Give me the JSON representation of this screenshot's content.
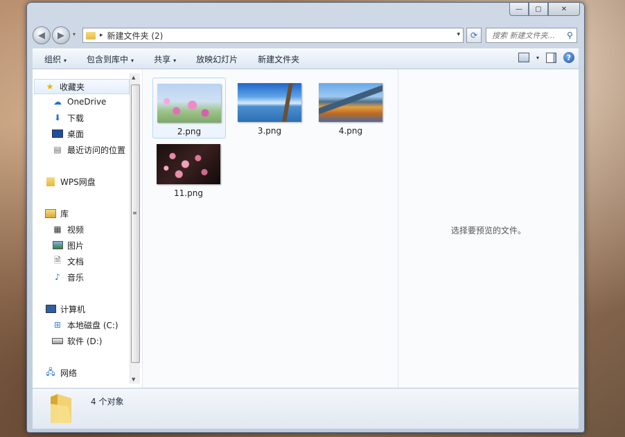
{
  "window": {
    "caption_buttons": [
      {
        "name": "minimize-button",
        "glyph": "—"
      },
      {
        "name": "maximize-button",
        "glyph": "▢"
      },
      {
        "name": "close-button",
        "glyph": "✕"
      }
    ]
  },
  "address": {
    "path": "新建文件夹 (2)",
    "separator": "▸",
    "dropdown_glyph": "▾",
    "refresh_glyph": "⟳"
  },
  "search": {
    "placeholder": "搜索 新建文件夹...",
    "icon_glyph": "🔍"
  },
  "toolbar": {
    "organize": "组织",
    "include_in_library": "包含到库中",
    "share": "共享",
    "slideshow": "放映幻灯片",
    "new_folder": "新建文件夹",
    "dropdown_glyph": "▾",
    "help_glyph": "?"
  },
  "nav": {
    "favorites": "收藏夹",
    "onedrive": "OneDrive",
    "downloads": "下载",
    "desktop": "桌面",
    "recent": "最近访问的位置",
    "wps": "WPS网盘",
    "libraries": "库",
    "videos": "视频",
    "pictures": "图片",
    "documents": "文档",
    "music": "音乐",
    "computer": "计算机",
    "local_disk": "本地磁盘 (C:)",
    "software_disk": "软件 (D:)",
    "network": "网络"
  },
  "files": [
    {
      "name": "2.png"
    },
    {
      "name": "3.png"
    },
    {
      "name": "4.png"
    },
    {
      "name": "11.png"
    }
  ],
  "preview": {
    "empty_text": "选择要预览的文件。"
  },
  "status": {
    "count_text": "4 个对象"
  },
  "colors": {
    "accent": "#2b5ea8",
    "toolbar_bg": "#dde7f2",
    "selection_border": "#b8d6fb"
  }
}
